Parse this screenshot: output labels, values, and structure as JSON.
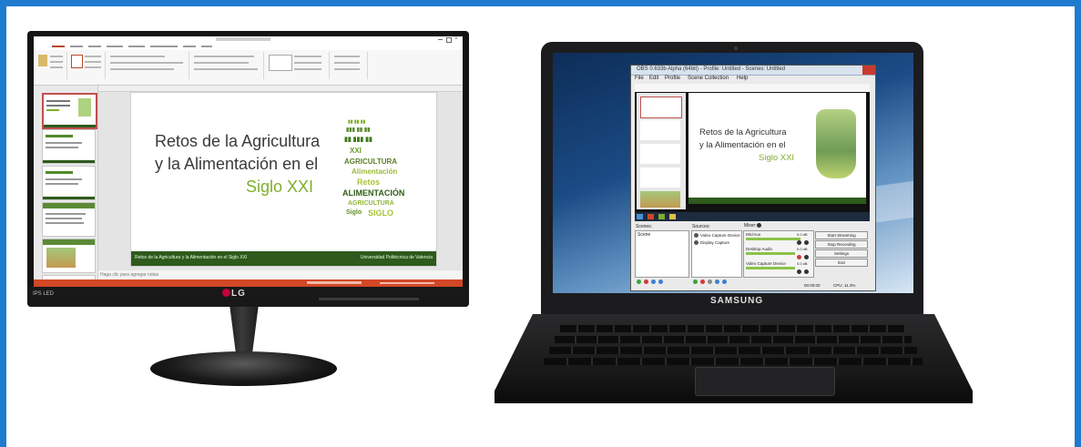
{
  "monitor": {
    "brand": "LG",
    "badge": "IPS LED",
    "powerpoint": {
      "slide": {
        "title_line1": "Retos de la Agricultura",
        "title_line2": "y la Alimentación en el",
        "title_line3": "Siglo XXI",
        "footer_left": "Retos de la Agricultura y la Alimentación en el Siglo XXI",
        "footer_right": "Universidad Politécnica de Valencia"
      },
      "word_cloud": [
        "AGRICULTURA",
        "Alimentación",
        "Retos",
        "ALIMENTACIÓN",
        "AGRICULTURA",
        "Siglo",
        "SIGLO",
        "XXI",
        "Retos"
      ],
      "notes_placeholder": "Haga clic para agregar notas",
      "status_color": "#d24726",
      "accent_green": "#2e5a1c"
    }
  },
  "laptop": {
    "brand": "SAMSUNG",
    "obs": {
      "title": "OBS 0.633b Alpha (64bit) - Profile: Untitled - Scenes: Untitled",
      "menu": [
        "File",
        "Edit",
        "Profile",
        "Scene Collection",
        "Help"
      ],
      "scenes_label": "Scenes:",
      "scenes_item": "Scene",
      "sources_label": "Sources:",
      "sources": [
        "Video Capture Device",
        "Display Capture"
      ],
      "mixer_label": "Mixer:",
      "mixer_channels": [
        "Mic/Aux",
        "Desktop Audio",
        "Video Capture Device"
      ],
      "mixer_db": "0.0 dB",
      "buttons": [
        "Start Streaming",
        "Stop Recording",
        "Settings",
        "Exit"
      ],
      "status_left": "00:00:00",
      "status_right": "CPU: 11.3%",
      "preview_slide": {
        "title_line1": "Retos de la Agricultura",
        "title_line2": "y la Alimentación en el",
        "title_line3": "Siglo XXI"
      }
    }
  }
}
